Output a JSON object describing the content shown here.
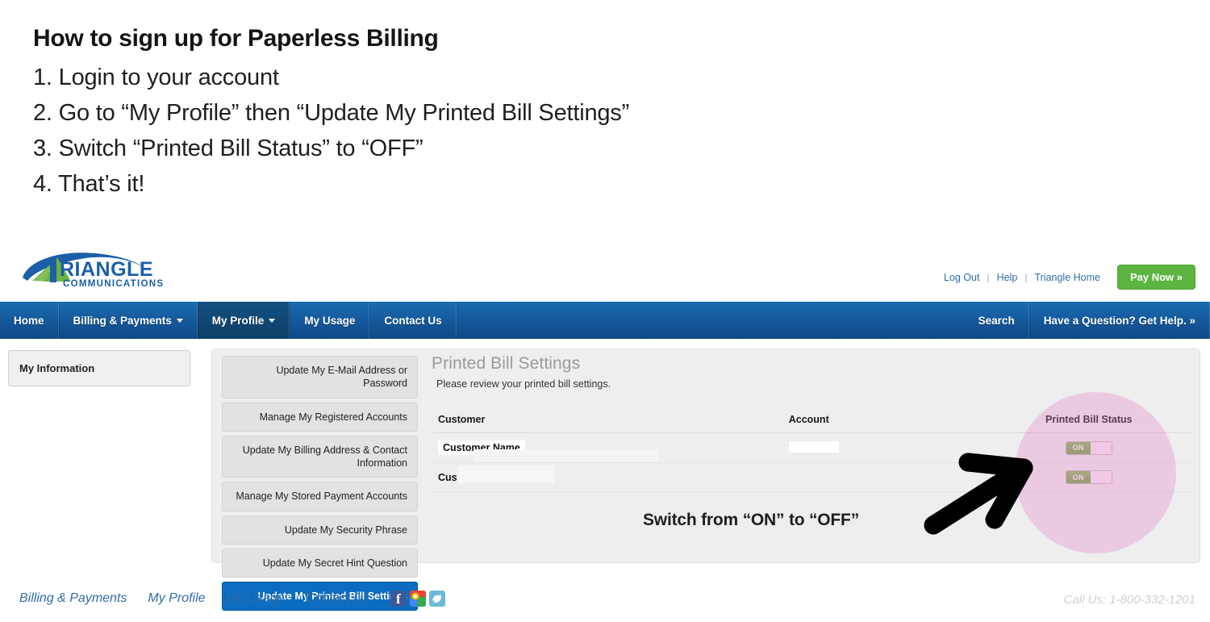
{
  "instructions": {
    "title": "How to sign up for Paperless Billing",
    "steps": [
      "1. Login to your account",
      "2. Go to “My Profile” then “Update My Printed Bill Settings”",
      "3. Switch “Printed Bill Status” to “OFF”",
      "4. That’s it!"
    ]
  },
  "brand": {
    "name": "TRIANGLE",
    "tagline": "COMMUNICATIONS",
    "green": "#6cb33f",
    "blue": "#1a5fa8"
  },
  "utility_nav": {
    "links": [
      "Log Out",
      "Help",
      "Triangle Home"
    ],
    "separator": "|",
    "pay_now_label": "Pay Now »",
    "pay_now_color": "#5cb441"
  },
  "main_nav": {
    "items": [
      {
        "label": "Home",
        "caret": false,
        "active": false
      },
      {
        "label": "Billing & Payments",
        "caret": true,
        "active": false
      },
      {
        "label": "My Profile",
        "caret": true,
        "active": true
      },
      {
        "label": "My Usage",
        "caret": false,
        "active": false
      },
      {
        "label": "Contact Us",
        "caret": false,
        "active": false
      }
    ],
    "right_items": [
      {
        "label": "Search"
      },
      {
        "label": "Have a Question? Get Help. »"
      }
    ],
    "accent": "#14579a"
  },
  "left_sidebar": {
    "heading": "My Information"
  },
  "profile_menu": {
    "items": [
      {
        "label": "Update My E-Mail Address or Password",
        "active": false
      },
      {
        "label": "Manage My Registered Accounts",
        "active": false
      },
      {
        "label": "Update My Billing Address & Contact Information",
        "active": false
      },
      {
        "label": "Manage My Stored Payment Accounts",
        "active": false
      },
      {
        "label": "Update My Security Phrase",
        "active": false
      },
      {
        "label": "Update My Secret Hint Question",
        "active": false
      },
      {
        "label": "Update My Printed Bill Settings",
        "active": true
      }
    ],
    "active_color": "#0b6cc0"
  },
  "panel": {
    "title": "Printed Bill Settings",
    "subtitle": "Please review your printed bill settings.",
    "table": {
      "columns": [
        "Customer",
        "Account",
        "Printed Bill Status"
      ],
      "rows": [
        {
          "customer": "Customer Name",
          "account": "",
          "status": "ON"
        },
        {
          "customer": "Customer Name",
          "account": "",
          "status": "ON"
        }
      ]
    }
  },
  "annotation": {
    "text": "Switch from “ON” to “OFF”",
    "highlight_color": "#e280c8",
    "arrow_color": "#000000"
  },
  "footer": {
    "links": [
      "Billing & Payments",
      "My Profile",
      "My Usage",
      "Contact Us"
    ],
    "social": [
      "facebook-icon",
      "google-plus-icon",
      "twitter-icon"
    ],
    "call_us": "Call Us: 1-800-332-1201"
  }
}
